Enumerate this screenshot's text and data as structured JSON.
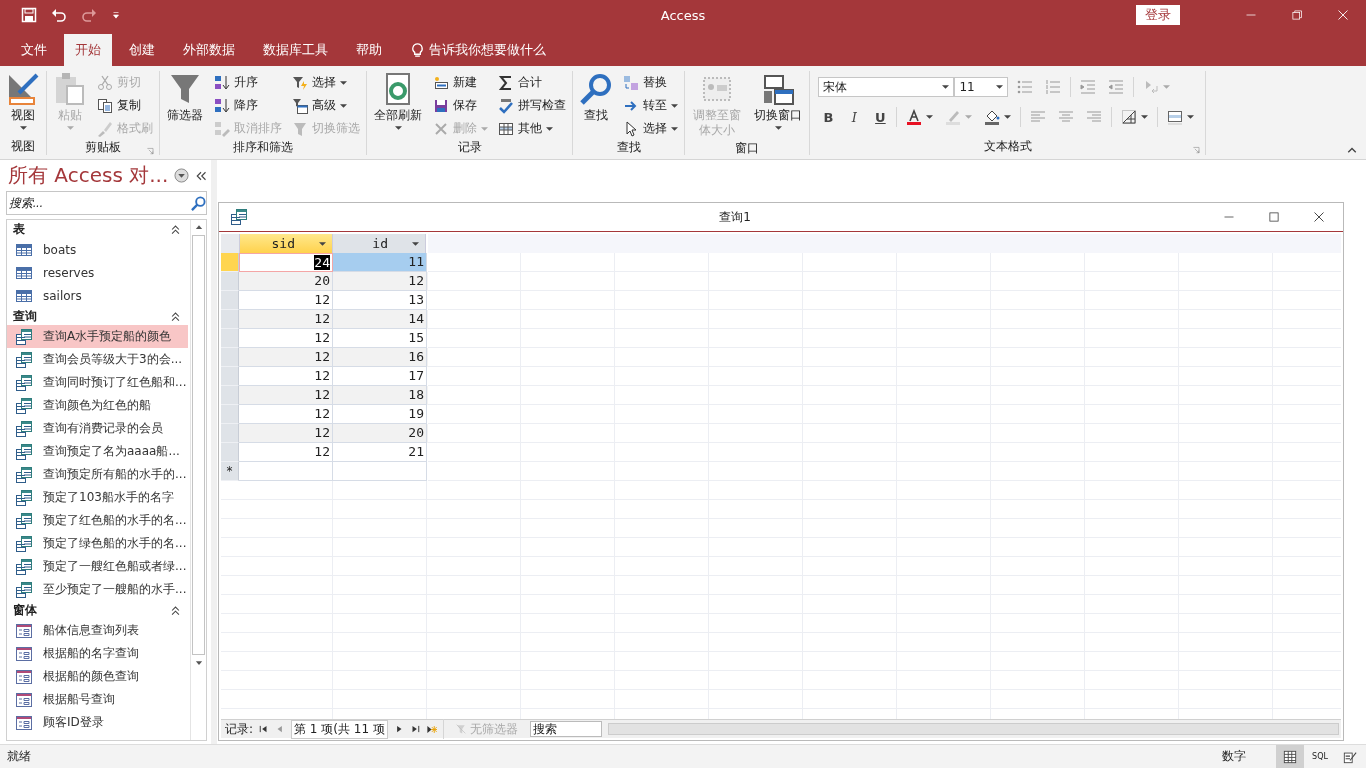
{
  "window": {
    "title": "Access",
    "sign_in": "登录"
  },
  "ribbon_tabs": [
    {
      "label": "文件",
      "selected": false
    },
    {
      "label": "开始",
      "selected": true
    },
    {
      "label": "创建",
      "selected": false
    },
    {
      "label": "外部数据",
      "selected": false
    },
    {
      "label": "数据库工具",
      "selected": false
    },
    {
      "label": "帮助",
      "selected": false
    }
  ],
  "tell_me": "告诉我你想要做什么",
  "ribbon_groups": [
    {
      "label": "视图",
      "launcher": false,
      "columns": [
        {
          "kind": "large",
          "label": "视图",
          "disabled": false,
          "dropdown": true
        }
      ]
    },
    {
      "label": "剪贴板",
      "launcher": true,
      "columns": [
        {
          "kind": "large",
          "label": "粘贴",
          "disabled": true,
          "dropdown": true
        },
        {
          "kind": "stack",
          "items": [
            {
              "label": "剪切",
              "disabled": true,
              "dropdown": false
            },
            {
              "label": "复制",
              "disabled": false,
              "dropdown": false
            },
            {
              "label": "格式刷",
              "disabled": true,
              "dropdown": false
            }
          ]
        }
      ]
    },
    {
      "label": "排序和筛选",
      "launcher": false,
      "columns": [
        {
          "kind": "large",
          "label": "筛选器",
          "disabled": false,
          "dropdown": false
        },
        {
          "kind": "stack",
          "items": [
            {
              "label": "升序",
              "disabled": false,
              "dropdown": false
            },
            {
              "label": "降序",
              "disabled": false,
              "dropdown": false
            },
            {
              "label": "取消排序",
              "disabled": true,
              "dropdown": false
            }
          ]
        },
        {
          "kind": "stack",
          "items": [
            {
              "label": "选择",
              "disabled": false,
              "dropdown": true
            },
            {
              "label": "高级",
              "disabled": false,
              "dropdown": true
            },
            {
              "label": "切换筛选",
              "disabled": true,
              "dropdown": false
            }
          ]
        }
      ]
    },
    {
      "label": "记录",
      "launcher": false,
      "columns": [
        {
          "kind": "large",
          "label": "全部刷新",
          "disabled": false,
          "dropdown": true
        },
        {
          "kind": "stack",
          "items": [
            {
              "label": "新建",
              "disabled": false,
              "dropdown": false
            },
            {
              "label": "保存",
              "disabled": false,
              "dropdown": false
            },
            {
              "label": "删除",
              "disabled": true,
              "dropdown": true
            }
          ]
        },
        {
          "kind": "stack",
          "items": [
            {
              "label": "合计",
              "disabled": false,
              "dropdown": false
            },
            {
              "label": "拼写检查",
              "disabled": false,
              "dropdown": false
            },
            {
              "label": "其他",
              "disabled": false,
              "dropdown": true
            }
          ]
        }
      ]
    },
    {
      "label": "查找",
      "launcher": false,
      "columns": [
        {
          "kind": "large",
          "label": "查找",
          "disabled": false,
          "dropdown": false
        },
        {
          "kind": "stack",
          "items": [
            {
              "label": "替换",
              "disabled": false,
              "dropdown": false
            },
            {
              "label": "转至",
              "disabled": false,
              "dropdown": true
            },
            {
              "label": "选择",
              "disabled": false,
              "dropdown": true
            }
          ]
        }
      ]
    },
    {
      "label": "窗口",
      "launcher": false,
      "columns": [
        {
          "kind": "large",
          "label": "调整至窗体大小",
          "disabled": true,
          "dropdown": false
        },
        {
          "kind": "large",
          "label": "切换窗口",
          "disabled": false,
          "dropdown": true
        }
      ]
    },
    {
      "label": "文本格式",
      "launcher": true,
      "columns": [
        {
          "kind": "format",
          "font": "宋体",
          "size": "11",
          "bold": "B",
          "italic": "I",
          "underline": "U"
        }
      ]
    }
  ],
  "nav_pane": {
    "title": "所有 Access 对...",
    "search_placeholder": "搜索...",
    "sections": [
      {
        "label": "表",
        "kind": "table",
        "expanded": true,
        "items": [
          {
            "label": "boats",
            "selected": false
          },
          {
            "label": "reserves",
            "selected": false
          },
          {
            "label": "sailors",
            "selected": false
          }
        ]
      },
      {
        "label": "查询",
        "kind": "query",
        "expanded": true,
        "items": [
          {
            "label": "查询A水手预定船的颜色",
            "selected": true
          },
          {
            "label": "查询会员等级大于3的会...",
            "selected": false
          },
          {
            "label": "查询同时预订了红色船和...",
            "selected": false
          },
          {
            "label": "查询颜色为红色的船",
            "selected": false
          },
          {
            "label": "查询有消费记录的会员",
            "selected": false
          },
          {
            "label": "查询预定了名为aaaa船...",
            "selected": false
          },
          {
            "label": "查询预定所有船的水手的...",
            "selected": false
          },
          {
            "label": "预定了103船水手的名字",
            "selected": false
          },
          {
            "label": "预定了红色船的水手的名...",
            "selected": false
          },
          {
            "label": "预定了绿色船的水手的名...",
            "selected": false
          },
          {
            "label": "预定了一艘红色船或者绿...",
            "selected": false
          },
          {
            "label": "至少预定了一艘船的水手...",
            "selected": false
          }
        ]
      },
      {
        "label": "窗体",
        "kind": "form",
        "expanded": true,
        "items": [
          {
            "label": "船体信息查询列表",
            "selected": false
          },
          {
            "label": "根据船的名字查询",
            "selected": false
          },
          {
            "label": "根据船的颜色查询",
            "selected": false
          },
          {
            "label": "根据船号查询",
            "selected": false
          },
          {
            "label": "顾客ID登录",
            "selected": false
          }
        ]
      }
    ]
  },
  "document": {
    "title": "查询1",
    "columns": [
      {
        "label": "sid",
        "selected": true
      },
      {
        "label": "id",
        "selected": false
      }
    ],
    "rows": [
      {
        "selected": true,
        "cells": [
          "24",
          "11"
        ]
      },
      {
        "selected": false,
        "cells": [
          "20",
          "12"
        ]
      },
      {
        "selected": false,
        "cells": [
          "12",
          "13"
        ]
      },
      {
        "selected": false,
        "cells": [
          "12",
          "14"
        ]
      },
      {
        "selected": false,
        "cells": [
          "12",
          "15"
        ]
      },
      {
        "selected": false,
        "cells": [
          "12",
          "16"
        ]
      },
      {
        "selected": false,
        "cells": [
          "12",
          "17"
        ]
      },
      {
        "selected": false,
        "cells": [
          "12",
          "18"
        ]
      },
      {
        "selected": false,
        "cells": [
          "12",
          "19"
        ]
      },
      {
        "selected": false,
        "cells": [
          "12",
          "20"
        ]
      },
      {
        "selected": false,
        "cells": [
          "12",
          "21"
        ]
      }
    ],
    "new_row_marker": "*",
    "navigator": {
      "label": "记录:",
      "position": "第 1 项(共 11 项",
      "filter": "无筛选器",
      "filter_disabled": true,
      "search_placeholder": "搜索"
    }
  },
  "status_bar": {
    "text": "就绪",
    "mode": "数字",
    "views": [
      {
        "kind": "datasheet",
        "selected": true
      },
      {
        "kind": "sql",
        "label": "SQL",
        "selected": false
      },
      {
        "kind": "design",
        "selected": false
      }
    ]
  }
}
